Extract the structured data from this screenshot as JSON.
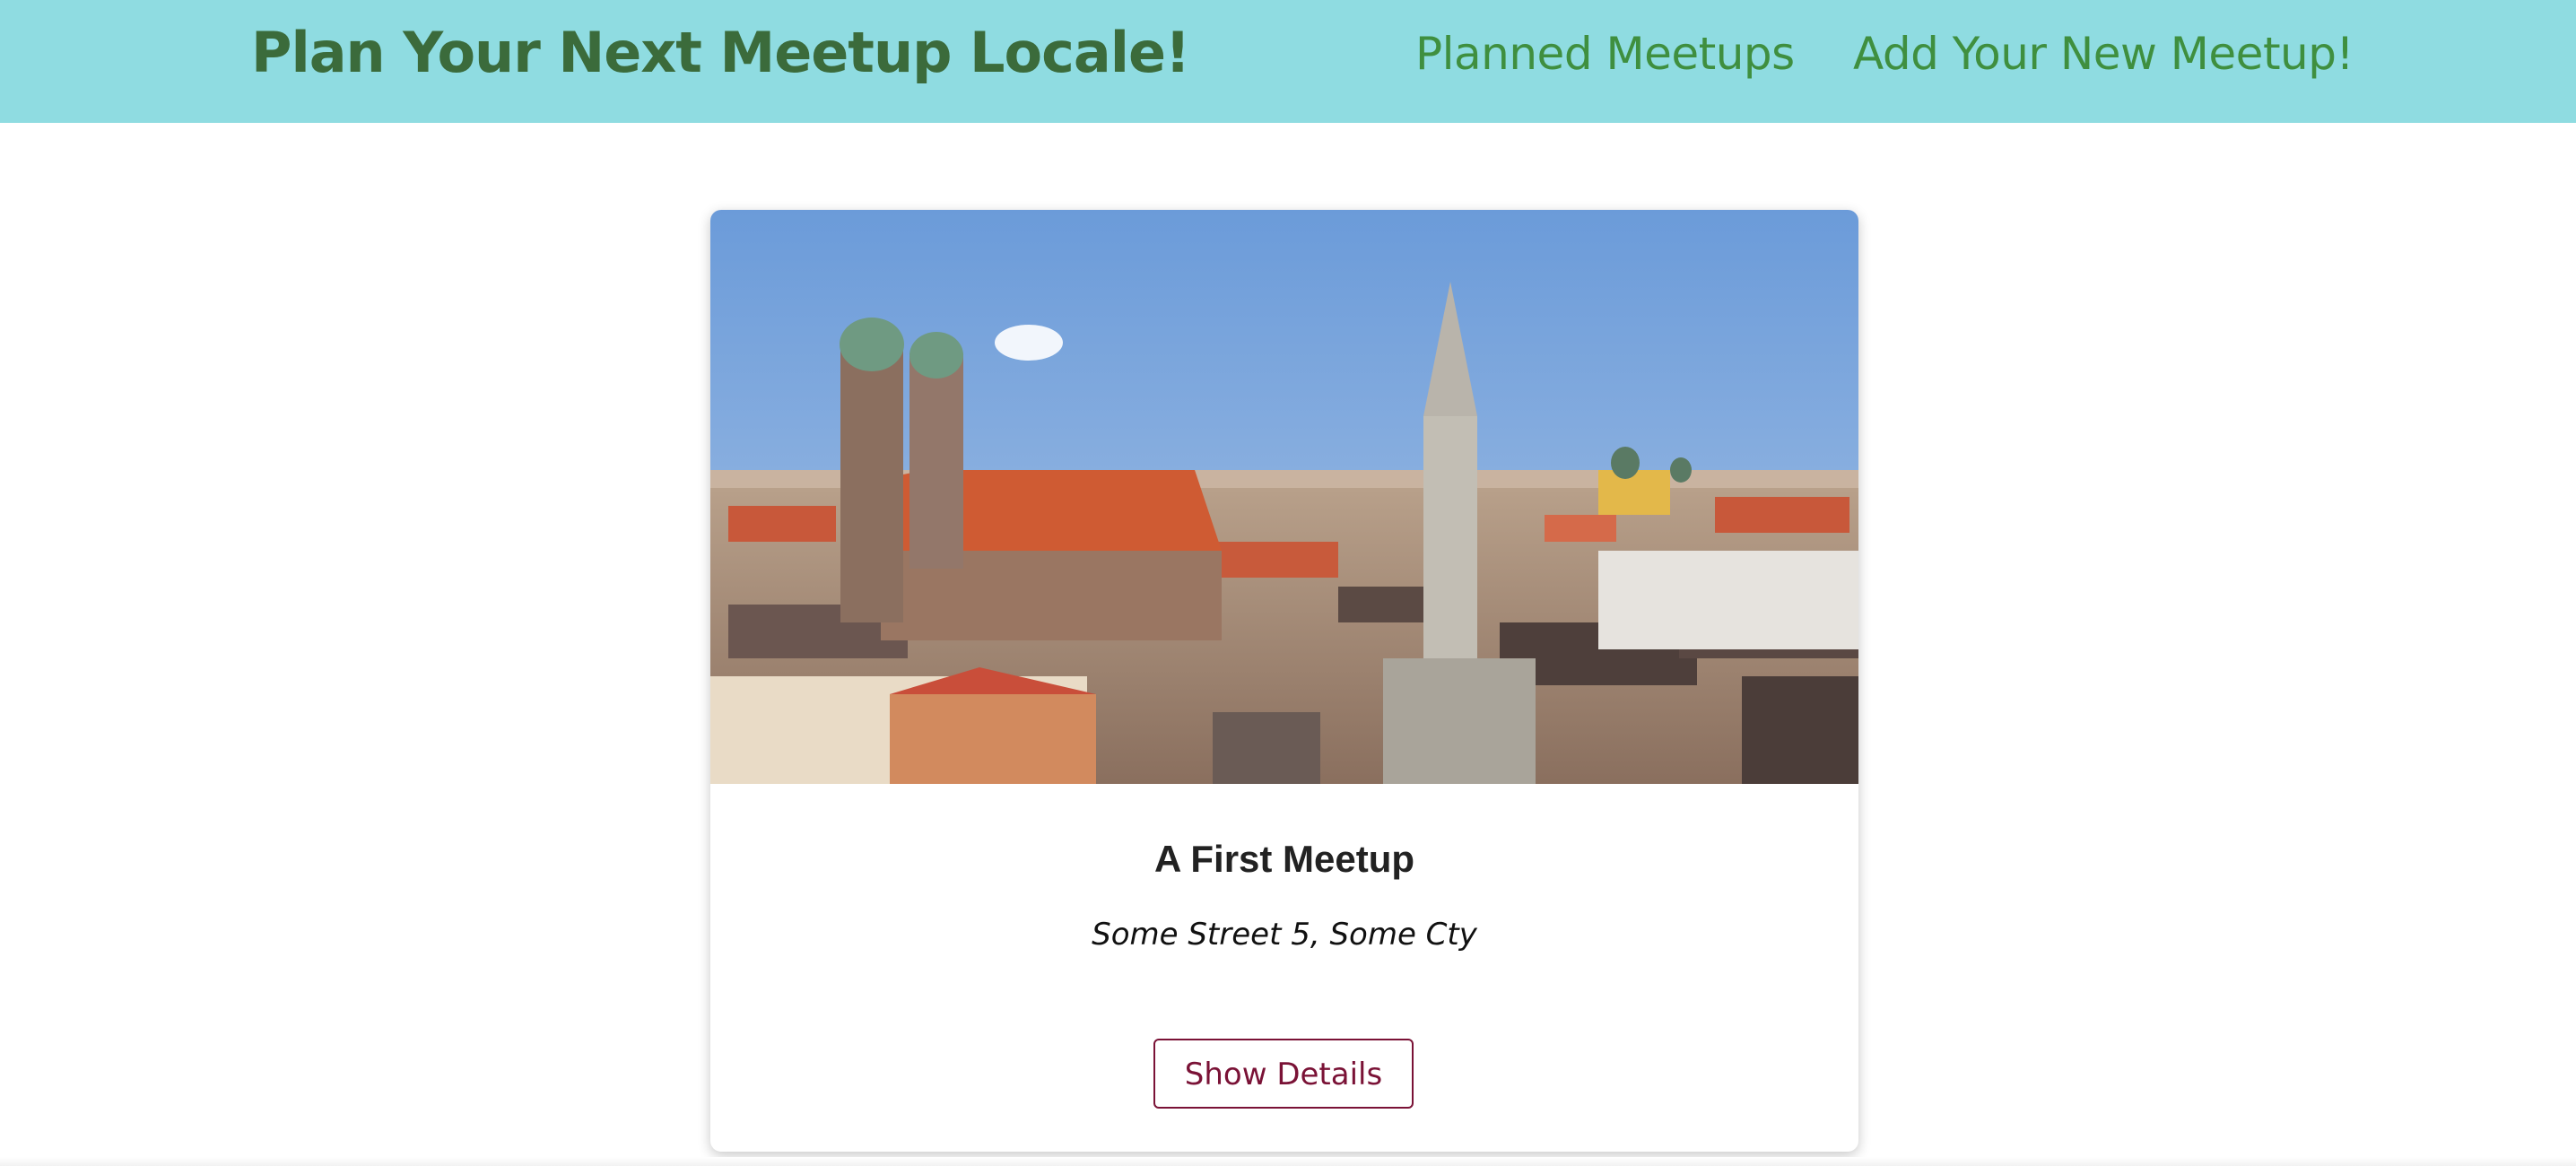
{
  "header": {
    "title": "Plan Your Next Meetup Locale!",
    "nav": {
      "planned": "Planned Meetups",
      "add": "Add Your New Meetup!"
    },
    "colors": {
      "background": "#8fdce1",
      "title": "#3b6b3b",
      "link": "#3f8f3f"
    }
  },
  "meetup_card": {
    "image_alt": "Munich city skyline with Frauenkirche and New Town Hall",
    "title": "A First Meetup",
    "address": "Some Street 5, Some Cty",
    "button_label": "Show Details",
    "colors": {
      "button": "#7a1236"
    }
  }
}
